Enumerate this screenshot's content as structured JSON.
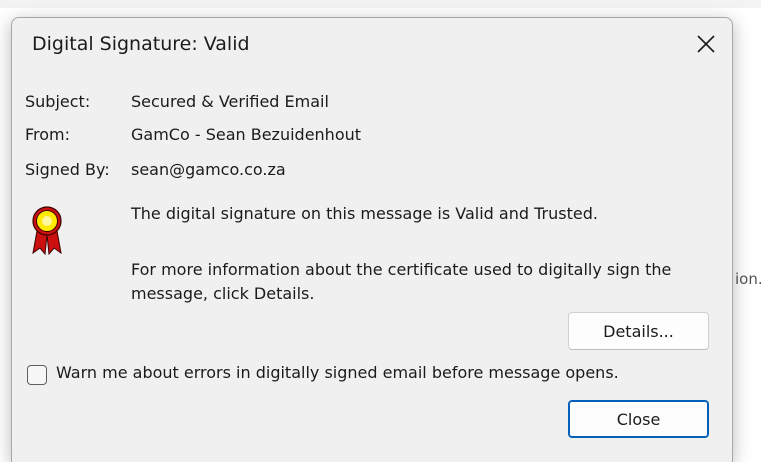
{
  "background": {
    "text_fragment": "ion."
  },
  "dialog": {
    "title": "Digital Signature: Valid",
    "close_icon": "close-icon",
    "fields": {
      "subject_label": "Subject:",
      "subject_value": "Secured & Verified Email",
      "from_label": "From:",
      "from_value": "GamCo - Sean Bezuidenhout",
      "signed_by_label": "Signed By:",
      "signed_by_value": "sean@gamco.co.za"
    },
    "seal_icon": "award-ribbon-icon",
    "message_line1": "The digital signature on this message is Valid and Trusted.",
    "message_line2": "For more information about the certificate used to digitally sign the message, click Details.",
    "details_button": "Details...",
    "warn_checkbox_label": "Warn me about errors in digitally signed email before message opens.",
    "warn_checked": false,
    "close_button": "Close"
  },
  "colors": {
    "dialog_bg": "#f0f0f0",
    "accent_border": "#005fb8",
    "seal_red": "#cc1010",
    "seal_yellow": "#ffea00"
  }
}
